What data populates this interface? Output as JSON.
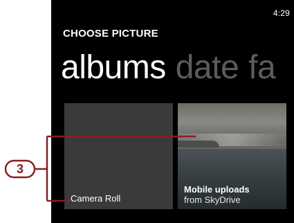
{
  "status_bar": {
    "time": "4:29"
  },
  "header": {
    "title": "CHOOSE PICTURE"
  },
  "pivot": {
    "items": [
      {
        "label": "albums",
        "active": true
      },
      {
        "label": "date",
        "active": false
      },
      {
        "label": "fa",
        "active": false
      }
    ]
  },
  "albums": [
    {
      "name": "Camera Roll",
      "subtitle": ""
    },
    {
      "name": "Mobile uploads",
      "subtitle": "from SkyDrive"
    }
  ],
  "callout": {
    "number": "3",
    "color": "#8a1e22"
  }
}
